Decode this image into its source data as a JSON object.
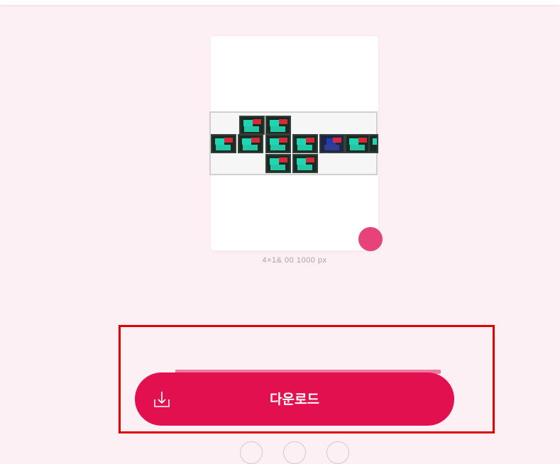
{
  "header": {},
  "preview": {
    "caption": "4×1& 00 1000 px",
    "sticker_count": 11
  },
  "actions": {
    "download_label": "다운로드",
    "download_icon": "download-tray-icon",
    "upload_progress": 0.85
  },
  "pagination": {
    "dots": 3
  },
  "colors": {
    "background": "#fdf0f4",
    "accent": "#e3104f",
    "highlight": "#e00000",
    "badge": "#e8427a"
  }
}
